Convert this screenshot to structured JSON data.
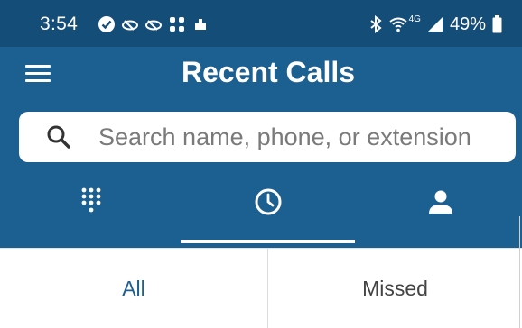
{
  "status_bar": {
    "time": "3:54",
    "battery": "49%",
    "network_label": "4G",
    "icons": [
      "verified-icon",
      "cloud-icon",
      "cloud-icon",
      "grid-apps-icon",
      "gesture-icon",
      "bluetooth-icon",
      "wifi-icon",
      "signal-icon",
      "battery-icon"
    ]
  },
  "app_bar": {
    "title": "Recent Calls",
    "menu_icon": "hamburger-menu-icon"
  },
  "search": {
    "placeholder": "Search name, phone, or extension",
    "value": "",
    "icon": "search-icon"
  },
  "tabs": [
    {
      "id": "dialpad",
      "icon": "dialpad-icon",
      "selected": false
    },
    {
      "id": "recents",
      "icon": "clock-icon",
      "selected": true
    },
    {
      "id": "contacts",
      "icon": "person-icon",
      "selected": false
    }
  ],
  "filters": {
    "all_label": "All",
    "missed_label": "Missed",
    "selected": "All"
  },
  "colors": {
    "header_blue": "#1c5f91",
    "status_bar_blue": "#154d79",
    "accent": "#1c5f91"
  }
}
